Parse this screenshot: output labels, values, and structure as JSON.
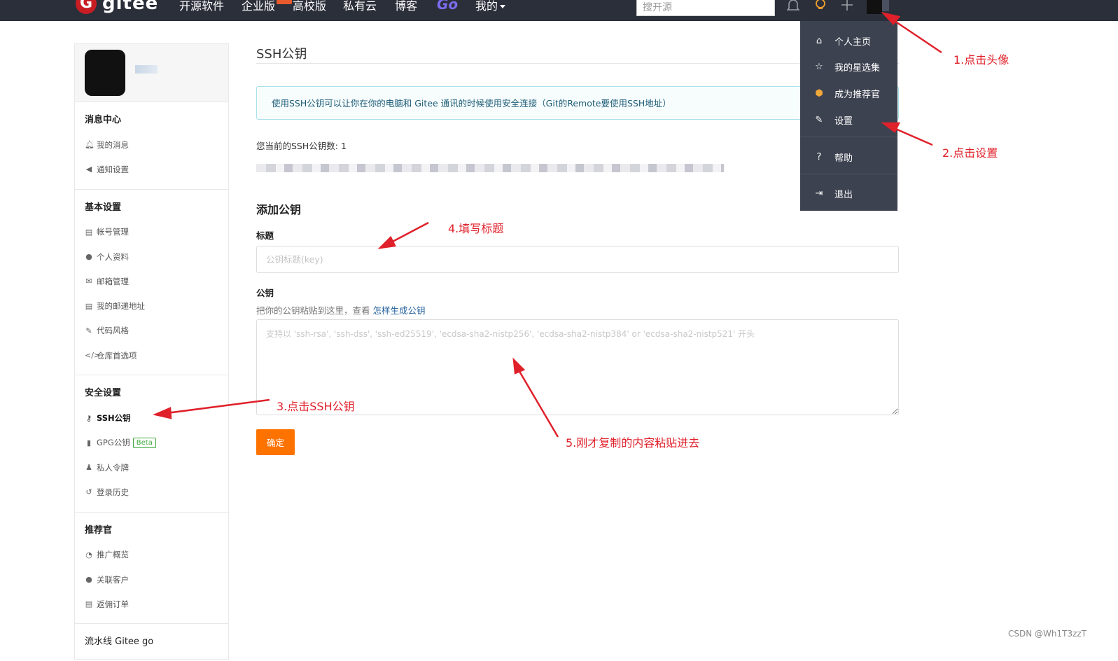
{
  "topbar": {
    "logo_mark": "G",
    "logo_text": "gitee",
    "nav": [
      "开源软件",
      "企业版",
      "高校版",
      "私有云",
      "博客"
    ],
    "go_label": "Go",
    "mine_label": "我的",
    "search_placeholder": "搜开源",
    "icons": [
      "bell-icon",
      "bulb-icon",
      "plus-icon"
    ]
  },
  "sidebar": {
    "groups": [
      {
        "title": "消息中心",
        "items": [
          {
            "label": "我的消息",
            "icon": "bell-icon"
          },
          {
            "label": "通知设置",
            "icon": "speaker-icon"
          }
        ]
      },
      {
        "title": "基本设置",
        "items": [
          {
            "label": "帐号管理",
            "icon": "id-card-icon"
          },
          {
            "label": "个人资料",
            "icon": "user-icon"
          },
          {
            "label": "邮箱管理",
            "icon": "mail-icon"
          },
          {
            "label": "我的邮递地址",
            "icon": "address-card-icon"
          },
          {
            "label": "代码风格",
            "icon": "brush-icon"
          },
          {
            "label": "仓库首选项",
            "icon": "code-icon"
          }
        ]
      },
      {
        "title": "安全设置",
        "items": [
          {
            "label": "SSH公钥",
            "icon": "key-icon"
          },
          {
            "label": "GPG公钥",
            "icon": "lock-icon",
            "badge": "Beta"
          },
          {
            "label": "私人令牌",
            "icon": "token-icon"
          },
          {
            "label": "登录历史",
            "icon": "history-icon"
          }
        ]
      },
      {
        "title": "推荐官",
        "items": [
          {
            "label": "推广概览",
            "icon": "chart-icon"
          },
          {
            "label": "关联客户",
            "icon": "users-icon"
          },
          {
            "label": "返佣订单",
            "icon": "order-icon"
          }
        ]
      }
    ],
    "bottom_group_title": "流水线 Gitee go"
  },
  "main": {
    "title": "SSH公钥",
    "info": "使用SSH公钥可以让你在你的电脑和 Gitee 通讯的时候使用安全连接（Git的Remote要使用SSH地址）",
    "key_count": "您当前的SSH公钥数: 1",
    "add_title": "添加公钥",
    "title_label": "标题",
    "title_placeholder": "公钥标题(key)",
    "key_label": "公钥",
    "hint": "把你的公钥粘贴到这里，查看 ",
    "hint_link": "怎样生成公钥",
    "key_placeholder": "支持以 'ssh-rsa', 'ssh-dss', 'ssh-ed25519', 'ecdsa-sha2-nistp256', 'ecdsa-sha2-nistp384' or 'ecdsa-sha2-nistp521' 开头",
    "submit": "确定"
  },
  "dropdown": {
    "items": [
      {
        "label": "个人主页",
        "icon": "home-icon"
      },
      {
        "label": "我的星选集",
        "icon": "star-icon"
      },
      {
        "label": "成为推荐官",
        "icon": "gitee-badge-icon"
      },
      {
        "label": "设置",
        "icon": "edit-icon"
      },
      {
        "label": "帮助",
        "icon": "help-icon"
      },
      {
        "label": "退出",
        "icon": "logout-icon"
      }
    ]
  },
  "annotations": [
    "1.点击头像",
    "2.点击设置",
    "3.点击SSH公钥",
    "4.填写标题",
    "5.刚才复制的内容粘贴进去"
  ],
  "watermark": "CSDN @Wh1T3zzT"
}
